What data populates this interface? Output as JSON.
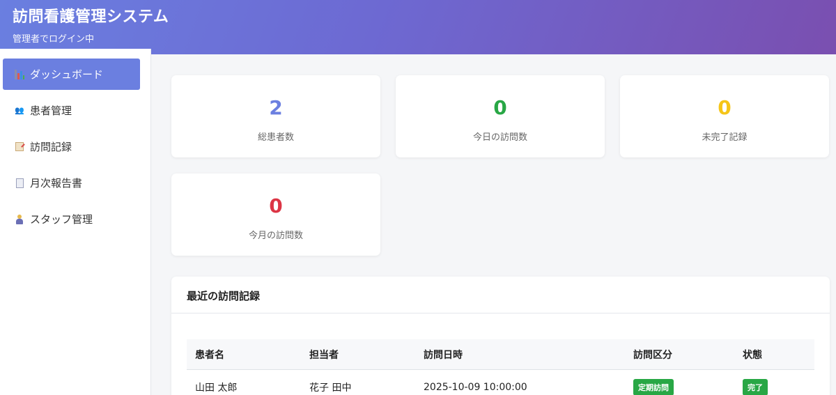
{
  "header": {
    "title": "訪問看護管理システム",
    "subtitle": "管理者でログイン中"
  },
  "sidebar": {
    "items": [
      {
        "label": "ダッシュボード",
        "icon": "bar-chart-icon",
        "active": true
      },
      {
        "label": "患者管理",
        "icon": "users-icon",
        "active": false
      },
      {
        "label": "訪問記録",
        "icon": "memo-icon",
        "active": false
      },
      {
        "label": "月次報告書",
        "icon": "document-icon",
        "active": false
      },
      {
        "label": "スタッフ管理",
        "icon": "staff-icon",
        "active": false
      }
    ]
  },
  "stats": [
    {
      "value": "2",
      "label": "総患者数",
      "color": "#6b7fe0"
    },
    {
      "value": "0",
      "label": "今日の訪問数",
      "color": "#28a745"
    },
    {
      "value": "0",
      "label": "未完了記録",
      "color": "#f5c518"
    },
    {
      "value": "0",
      "label": "今月の訪問数",
      "color": "#dc3545"
    }
  ],
  "recent": {
    "title": "最近の訪問記録",
    "columns": [
      "患者名",
      "担当者",
      "訪問日時",
      "訪問区分",
      "状態"
    ],
    "rows": [
      {
        "patient": "山田 太郎",
        "staff": "花子 田中",
        "datetime": "2025-10-09 10:00:00",
        "type": "定期訪問",
        "status": "完了"
      }
    ]
  },
  "colors": {
    "accent": "#6b7fe0",
    "success": "#28a745"
  }
}
